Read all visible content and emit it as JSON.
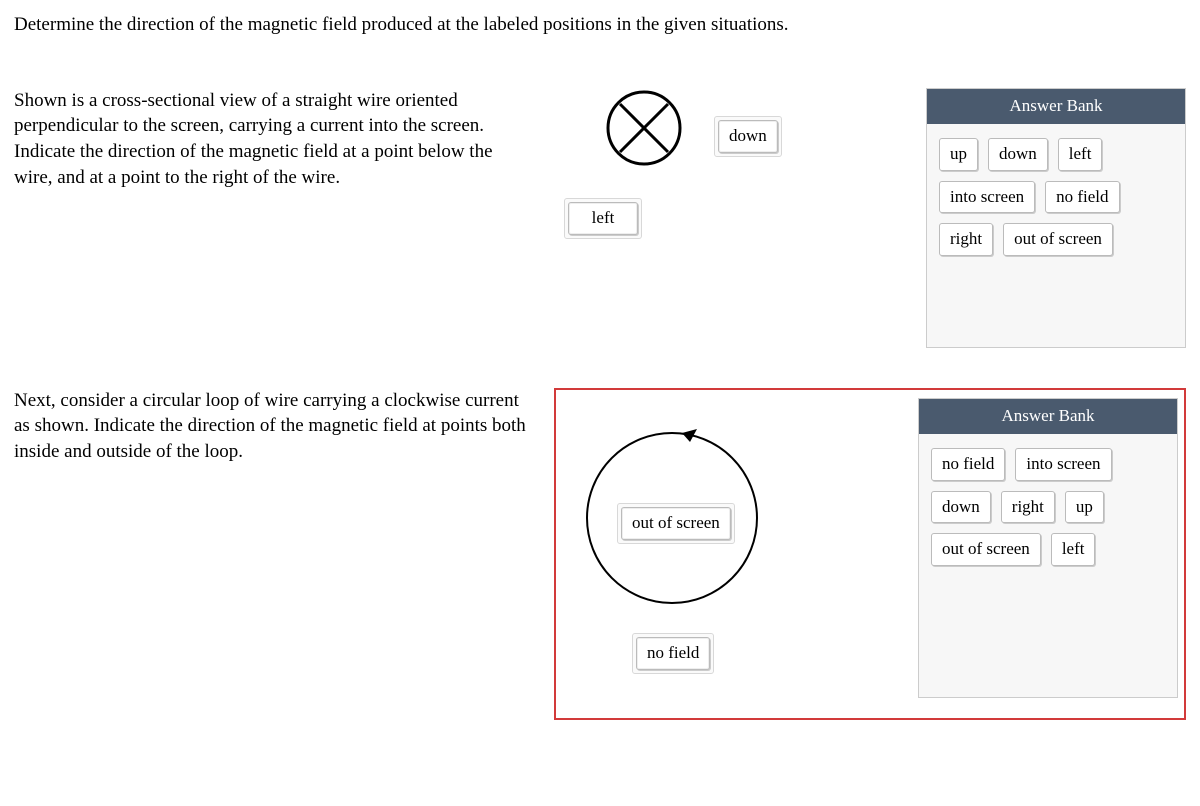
{
  "instruction": "Determine the direction of the magnetic field produced at the labeled positions in the given situations.",
  "q1": {
    "prompt": "Shown is a cross-sectional view of a straight wire oriented perpendicular to the screen, carrying a current into the screen. Indicate the direction of the magnetic field at a point below the wire, and at a point to the right of the wire.",
    "drop_right": "down",
    "drop_below": "left",
    "bank_title": "Answer Bank",
    "bank": [
      "up",
      "down",
      "left",
      "into screen",
      "no field",
      "right",
      "out of screen"
    ]
  },
  "q2": {
    "prompt": "Next, consider a circular loop of wire carrying a clockwise current as shown. Indicate the direction of the magnetic field at points both inside and outside of the loop.",
    "drop_inside": "out of screen",
    "drop_outside": "no field",
    "bank_title": "Answer Bank",
    "bank": [
      "no field",
      "into screen",
      "down",
      "right",
      "up",
      "out of screen",
      "left"
    ]
  }
}
